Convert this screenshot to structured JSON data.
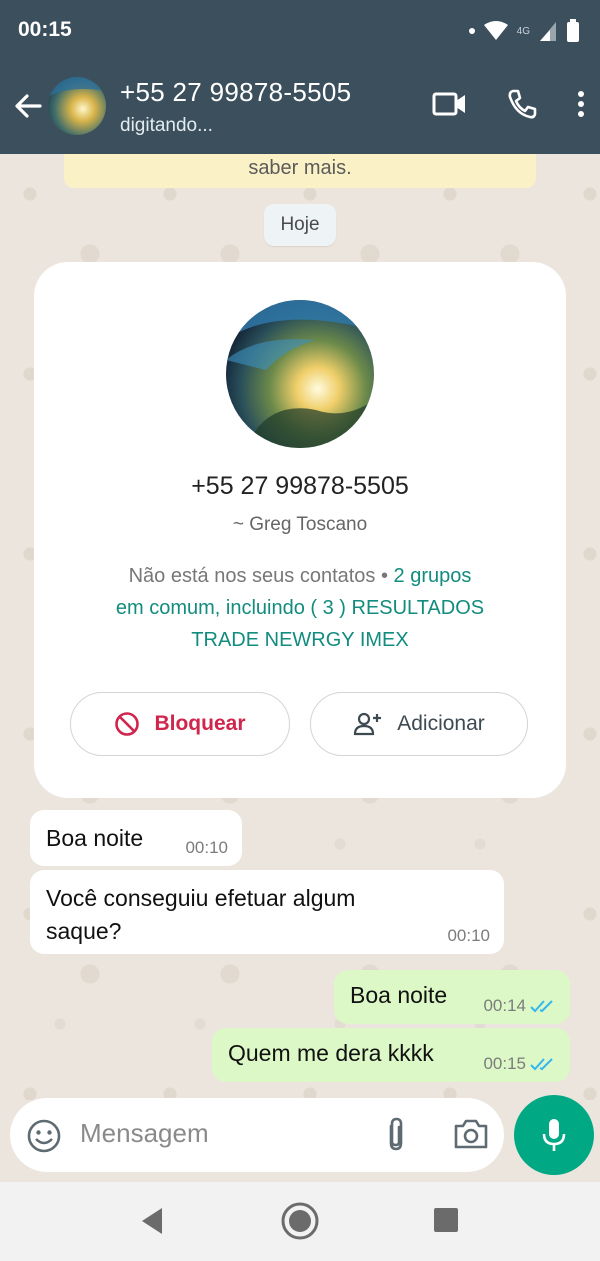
{
  "status_bar": {
    "time": "00:15",
    "network": "4G"
  },
  "header": {
    "contact": "+55 27 99878-5505",
    "status": "digitando..."
  },
  "chat": {
    "encryption_notice_tail": "saber mais.",
    "date_chip": "Hoje",
    "contact_card": {
      "phone": "+55 27 99878-5505",
      "name": "~ Greg Toscano",
      "info_plain": "Não está nos seus contatos • ",
      "info_groups_line1": "2 grupos",
      "info_groups_line2": "em comum, incluindo ( 3 ) RESULTADOS",
      "info_groups_line3": "TRADE NEWRGY IMEX",
      "block_label": "Bloquear",
      "add_label": "Adicionar"
    },
    "messages": [
      {
        "direction": "in",
        "text": "Boa noite",
        "time": "00:10"
      },
      {
        "direction": "in",
        "text": "Você conseguiu efetuar algum saque?",
        "time": "00:10"
      },
      {
        "direction": "out",
        "text": "Boa noite",
        "time": "00:14",
        "read": true
      },
      {
        "direction": "out",
        "text": "Quem me dera kkkk",
        "time": "00:15",
        "read": true
      }
    ]
  },
  "composer": {
    "placeholder": "Mensagem"
  },
  "colors": {
    "header": "#3b4f5c",
    "accent": "#00a884",
    "outgoing": "#dcf8c6",
    "block": "#d0254d",
    "link_green": "#128c7e",
    "read_ticks": "#34b7f1"
  }
}
